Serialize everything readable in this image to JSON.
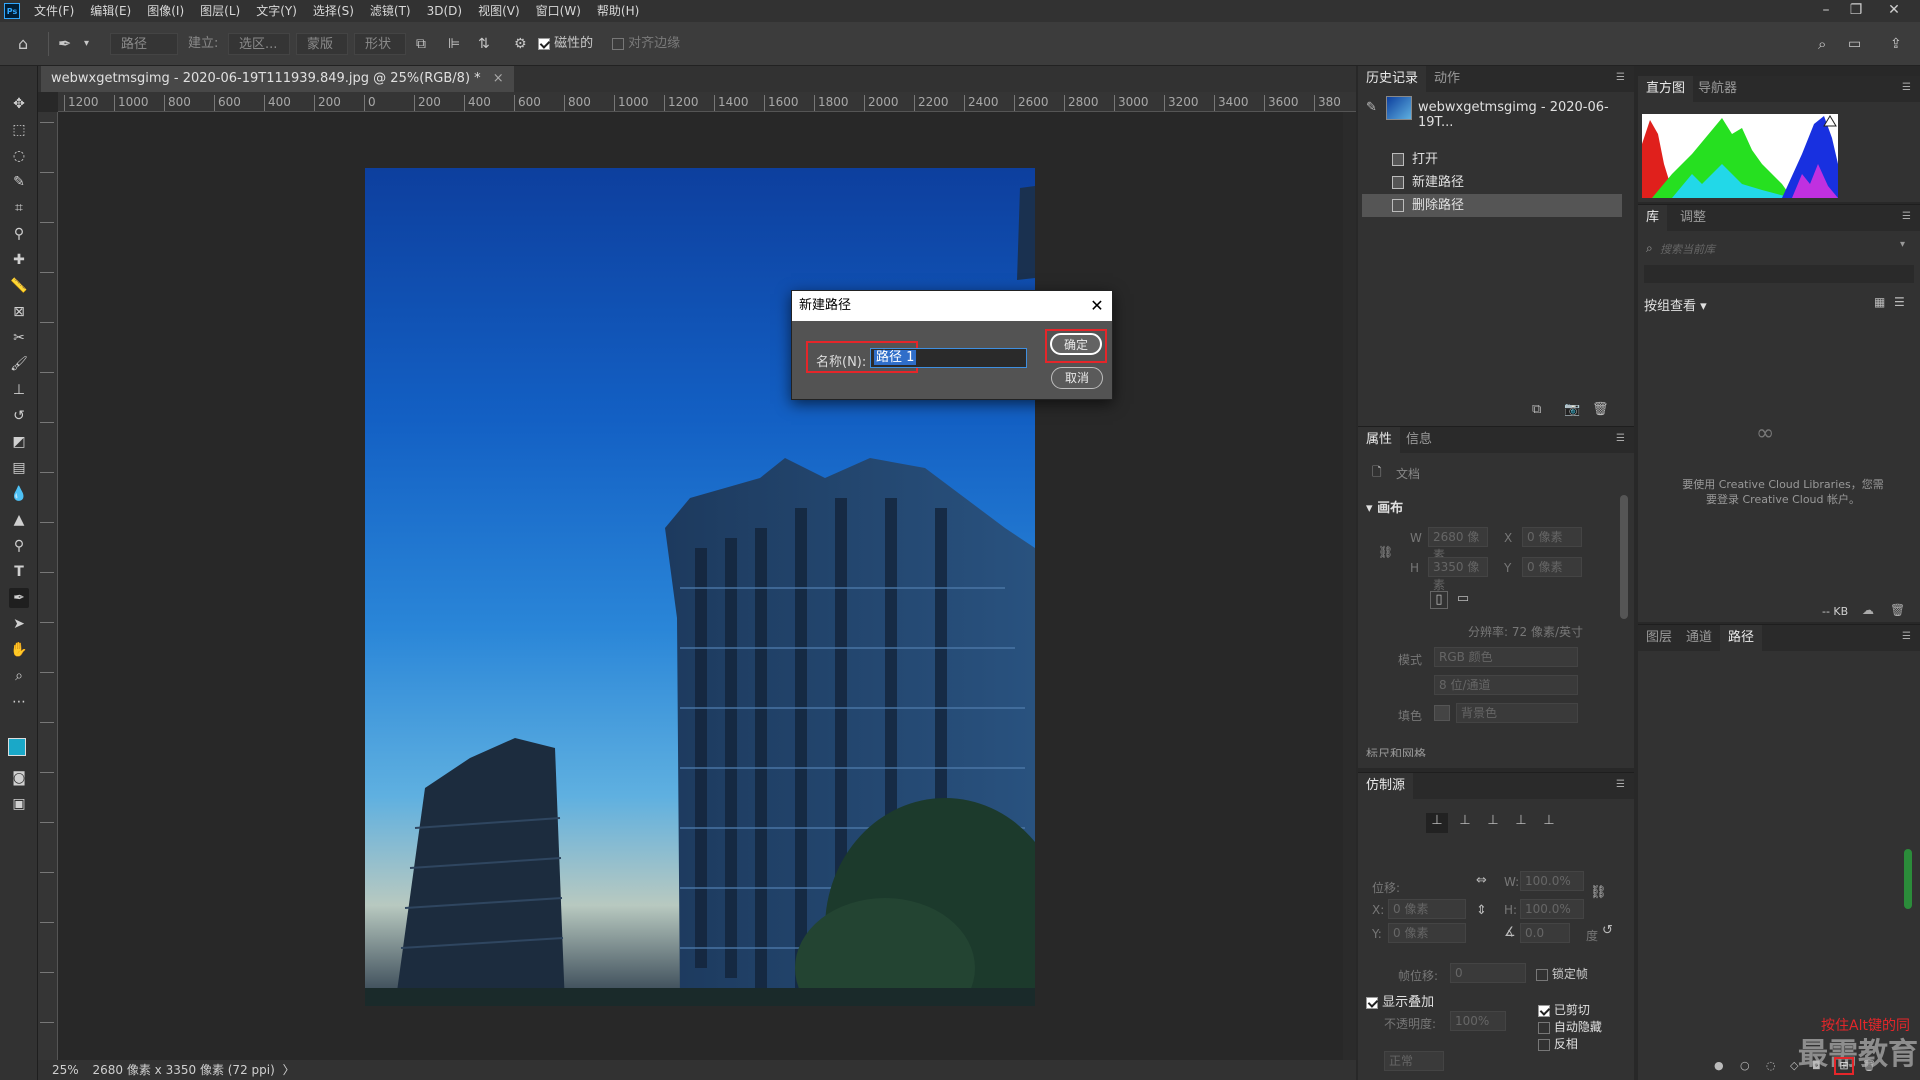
{
  "menubar": {
    "logo": "Ps",
    "items": [
      "文件(F)",
      "编辑(E)",
      "图像(I)",
      "图层(L)",
      "文字(Y)",
      "选择(S)",
      "滤镜(T)",
      "3D(D)",
      "视图(V)",
      "窗口(W)",
      "帮助(H)"
    ],
    "minimize": "–",
    "restore": "❐",
    "close": "✕"
  },
  "options": {
    "mode": "路径",
    "make_label": "建立:",
    "selection_btn": "选区...",
    "mask_btn": "蒙版",
    "shape_btn": "形状",
    "magnetic_label": "磁性的",
    "align_edges_label": "对齐边缘"
  },
  "document": {
    "tab_title": "webwxgetmsgimg - 2020-06-19T111939.849.jpg @ 25%(RGB/8) *",
    "tab_close": "×",
    "ruler_h": [
      "1200",
      "1000",
      "800",
      "600",
      "400",
      "200",
      "0",
      "200",
      "400",
      "600",
      "800",
      "1000",
      "1200",
      "1400",
      "1600",
      "1800",
      "2000",
      "2200",
      "2400",
      "2600",
      "2800",
      "3000",
      "3200",
      "3400",
      "3600",
      "380"
    ],
    "zoom": "25%",
    "info": "2680 像素 x 3350 像素 (72 ppi)"
  },
  "dialog": {
    "title": "新建路径",
    "close": "✕",
    "name_label": "名称(N):",
    "name_value": "路径 1",
    "ok": "确定",
    "cancel": "取消"
  },
  "history": {
    "tabs": [
      "历史记录",
      "动作"
    ],
    "snapshot": "webwxgetmsgimg - 2020-06-19T...",
    "items": [
      "打开",
      "新建路径",
      "删除路径"
    ]
  },
  "histogram": {
    "tabs": [
      "直方图",
      "导航器"
    ]
  },
  "library": {
    "tabs": [
      "库",
      "调整"
    ],
    "search_placeholder": "搜索当前库",
    "view_by": "按组查看",
    "message": "要使用 Creative Cloud Libraries，您需要登录 Creative Cloud 帐户。",
    "size": "-- KB"
  },
  "properties": {
    "tabs": [
      "属性",
      "信息"
    ],
    "doc_label": "文档",
    "canvas_title": "画布",
    "w_label": "W",
    "w_value": "2680 像素",
    "h_label": "H",
    "h_value": "3350 像素",
    "x_label": "X",
    "x_value": "0 像素",
    "y_label": "Y",
    "y_value": "0 像素",
    "resolution": "分辨率: 72 像素/英寸",
    "mode_label": "模式",
    "mode_value": "RGB 颜色",
    "depth_value": "8 位/通道",
    "fill_label": "填色",
    "fill_value": "背景色",
    "next_section": "标尺和网格"
  },
  "clone": {
    "tab": "仿制源",
    "offset_label": "位移:",
    "w_label": "W:",
    "w_value": "100.0%",
    "h_label": "H:",
    "h_value": "100.0%",
    "x_label": "X:",
    "x_value": "0 像素",
    "y_label": "Y:",
    "y_value": "0 像素",
    "angle_value": "0.0",
    "deg": "度",
    "frame_offset_label": "帧位移:",
    "frame_offset_value": "0",
    "lock_frame": "锁定帧",
    "show_overlay": "显示叠加",
    "opacity_label": "不透明度:",
    "opacity_value": "100%",
    "clipped": "已剪切",
    "auto_hide": "自动隐藏",
    "invert": "反相",
    "blend": "正常"
  },
  "layers": {
    "tabs": [
      "图层",
      "通道",
      "路径"
    ]
  },
  "watermark": {
    "hint": "按住Alt键的同",
    "brand": "最需教育"
  },
  "colors": {
    "accent_red": "#e5262a",
    "fg_swatch": "#1aa8c8",
    "bg_swatch": "#1ab0d8"
  }
}
